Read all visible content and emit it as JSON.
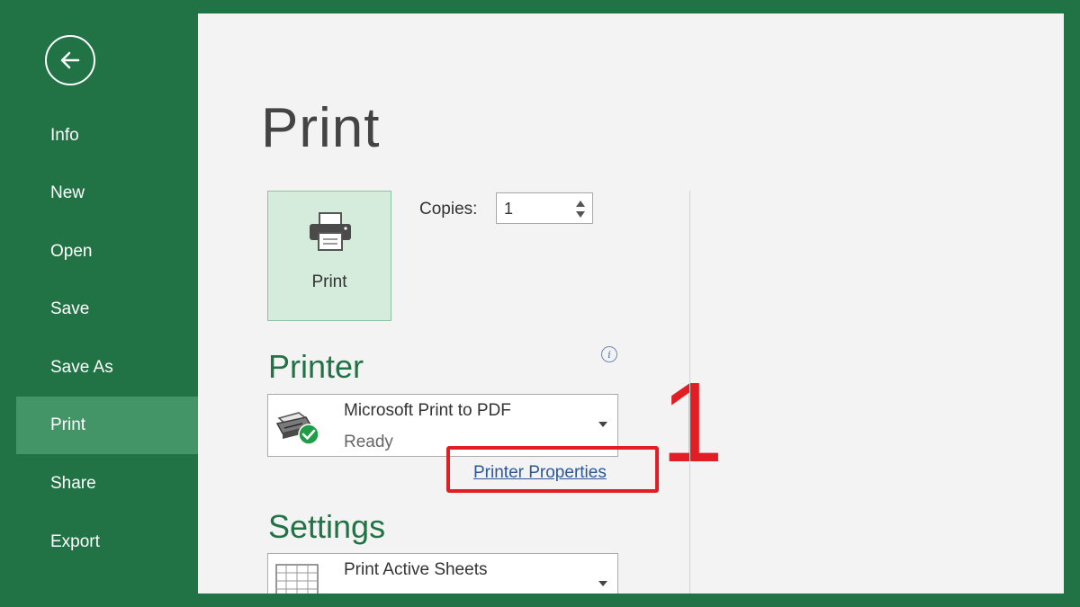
{
  "sidebar": {
    "back_icon": "back-arrow-icon",
    "items": [
      {
        "label": "Info",
        "active": false
      },
      {
        "label": "New",
        "active": false
      },
      {
        "label": "Open",
        "active": false
      },
      {
        "label": "Save",
        "active": false
      },
      {
        "label": "Save As",
        "active": false
      },
      {
        "label": "Print",
        "active": true
      },
      {
        "label": "Share",
        "active": false
      },
      {
        "label": "Export",
        "active": false
      }
    ]
  },
  "main": {
    "title": "Print",
    "print_button": {
      "label": "Print",
      "icon": "printer-icon"
    },
    "copies": {
      "label": "Copies:",
      "value": "1"
    },
    "printer": {
      "heading": "Printer",
      "info_icon": "info-icon",
      "selected_name": "Microsoft Print to PDF",
      "status": "Ready",
      "properties_link": "Printer Properties"
    },
    "settings": {
      "heading": "Settings",
      "selected": "Print Active Sheets"
    }
  },
  "annotation": {
    "number": "1",
    "color": "#e01e24"
  },
  "colors": {
    "brand_green": "#217346",
    "active_nav": "#439467",
    "link_blue": "#2b5797"
  }
}
